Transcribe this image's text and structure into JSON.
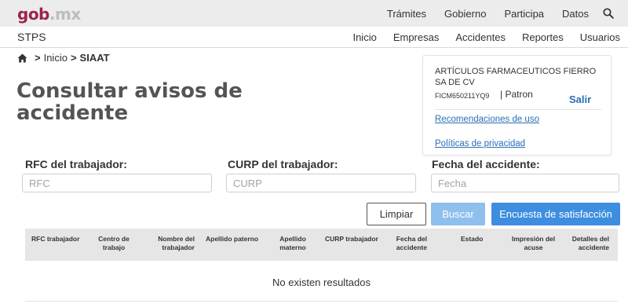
{
  "topbar": {
    "logo_main": "gob",
    "logo_ext": ".mx",
    "nav": [
      "Trámites",
      "Gobierno",
      "Participa",
      "Datos"
    ]
  },
  "subbar": {
    "brand": "STPS",
    "nav": [
      "Inicio",
      "Empresas",
      "Accidentes",
      "Reportes",
      "Usuarios"
    ]
  },
  "breadcrumb": {
    "items": [
      "Inicio",
      "SIAAT"
    ],
    "separator": ">"
  },
  "page": {
    "title": "Consultar avisos de accidente"
  },
  "user": {
    "company": "ARTÍCULOS FARMACEUTICOS FIERRO SA DE CV",
    "rfc": "FICM650211YQ9",
    "role": "| Patron",
    "logout": "Salir",
    "links": [
      "Recomendaciones de uso",
      "Políticas de privacidad"
    ]
  },
  "form": {
    "rfc_label": "RFC del trabajador:",
    "rfc_placeholder": "RFC",
    "curp_label": "CURP del trabajador:",
    "curp_placeholder": "CURP",
    "fecha_label": "Fecha del accidente:",
    "fecha_placeholder": "Fecha"
  },
  "actions": {
    "clear": "Limpiar",
    "search": "Buscar",
    "survey": "Encuesta de satisfacción"
  },
  "table": {
    "headers": [
      "RFC trabajador",
      "Centro de trabajo",
      "Nombre del trabajador",
      "Apellido paterno",
      "Apellido materno",
      "CURP trabajador",
      "Fecha del accidente",
      "Estado",
      "Impresión del acuse",
      "Detalles del accidente"
    ],
    "empty_message": "No existen resultados"
  },
  "colors": {
    "brand": "#9d2449",
    "link": "#2a6fb6",
    "primary_button": "#3d8ee0",
    "disabled_button": "#8fbfec"
  }
}
